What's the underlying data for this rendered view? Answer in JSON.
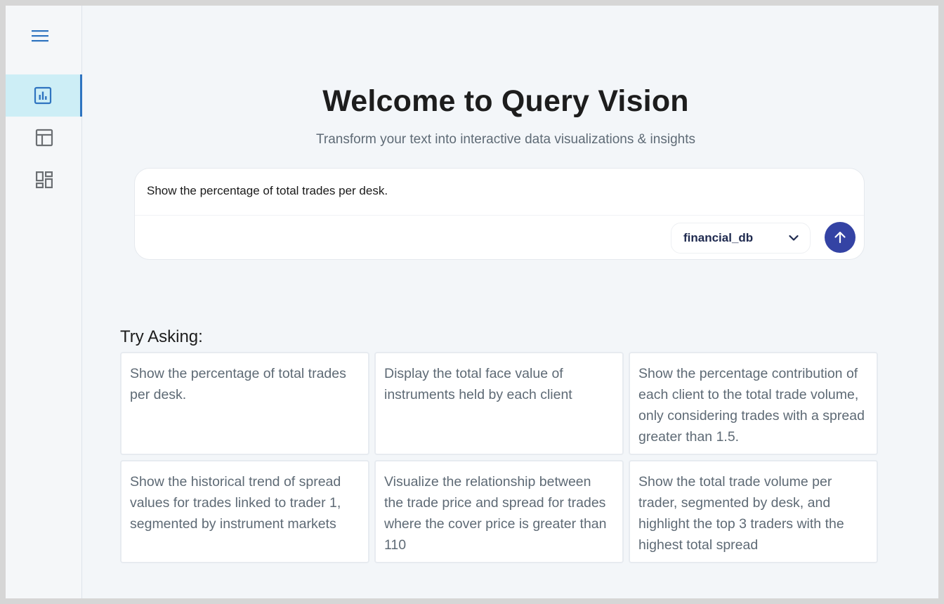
{
  "sidebar": {
    "menu_icon": "hamburger-menu-icon",
    "items": [
      {
        "icon": "bar-chart-icon",
        "active": true
      },
      {
        "icon": "table-icon",
        "active": false
      },
      {
        "icon": "dashboard-icon",
        "active": false
      }
    ],
    "accent_color": "#2f74c0",
    "active_bg": "#cdeef6"
  },
  "main": {
    "title": "Welcome to Query Vision",
    "subtitle": "Transform your text into interactive data visualizations & insights"
  },
  "query": {
    "value": "Show the percentage of total trades per desk.",
    "database": "financial_db",
    "dropdown_icon": "chevron-down-icon",
    "send_icon": "arrow-up-icon",
    "send_color": "#3443a4"
  },
  "suggestions": {
    "heading": "Try Asking:",
    "items": [
      "Show the percentage of total trades per desk.",
      "Display the total face value of instruments held by each client",
      "Show the percentage contribution of each client to the total trade volume, only considering trades with a spread greater than 1.5.",
      "Show the historical trend of spread values for trades linked to trader 1, segmented by instrument markets",
      "Visualize the relationship between the trade price and spread for trades where the cover price is greater than 110",
      "Show the total trade volume per trader, segmented by desk, and highlight the top 3 traders with the highest total spread"
    ]
  }
}
